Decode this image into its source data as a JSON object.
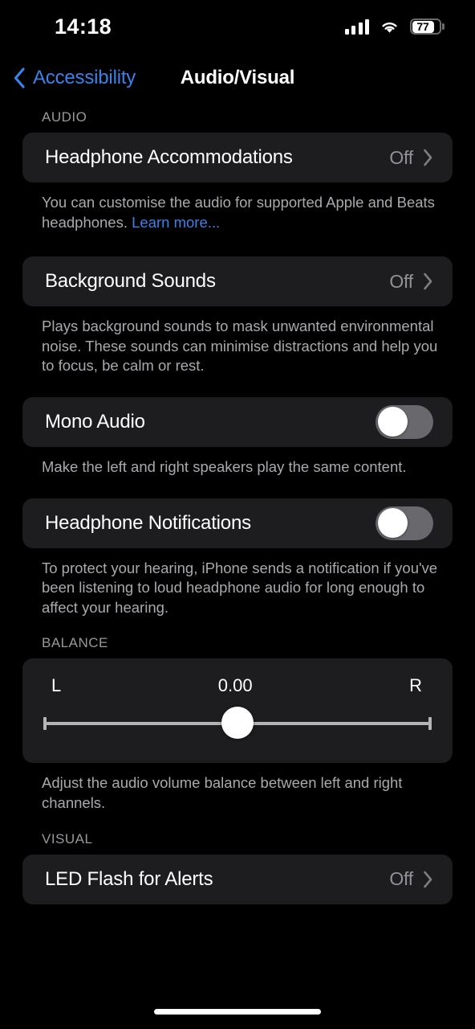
{
  "status_bar": {
    "time": "14:18",
    "signal_icon": "cellular-signal-icon",
    "wifi_icon": "wifi-icon",
    "battery_percent": "77",
    "battery_icon": "battery-icon"
  },
  "nav": {
    "back_label": "Accessibility",
    "back_icon": "chevron-left-icon",
    "title": "Audio/Visual"
  },
  "sections": [
    {
      "header": "AUDIO",
      "rows": [
        {
          "label": "Headphone Accommodations",
          "value": "Off",
          "type": "disclosure"
        }
      ],
      "footer": "You can customise the audio for supported Apple and Beats headphones. ",
      "footer_link": "Learn more..."
    },
    {
      "header": "",
      "rows": [
        {
          "label": "Background Sounds",
          "value": "Off",
          "type": "disclosure"
        }
      ],
      "footer": "Plays background sounds to mask unwanted environmental noise. These sounds can minimise distractions and help you to focus, be calm or rest."
    },
    {
      "header": "",
      "rows": [
        {
          "label": "Mono Audio",
          "value": "off",
          "type": "toggle"
        }
      ],
      "footer": "Make the left and right speakers play the same content."
    },
    {
      "header": "",
      "rows": [
        {
          "label": "Headphone Notifications",
          "value": "off",
          "type": "toggle"
        }
      ],
      "footer": "To protect your hearing, iPhone sends a notification if you've been listening to loud headphone audio for long enough to affect your hearing."
    }
  ],
  "balance": {
    "header": "BALANCE",
    "left_label": "L",
    "value": "0.00",
    "right_label": "R",
    "footer": "Adjust the audio volume balance between left and right channels."
  },
  "visual": {
    "header": "VISUAL",
    "row": {
      "label": "LED Flash for Alerts",
      "value": "Off"
    }
  },
  "colors": {
    "background": "#000000",
    "card": "#1d1d1f",
    "accent_blue": "#3b82e8",
    "secondary_text": "#a9a9ae",
    "toggle_off_track": "#68686d"
  },
  "home_indicator": "home-indicator"
}
